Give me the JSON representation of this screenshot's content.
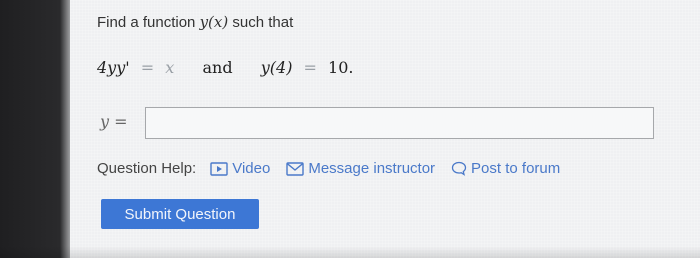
{
  "question": {
    "prompt_text": "Find a function",
    "prompt_math": "y(x)",
    "prompt_suffix": "such that",
    "equation_lhs": "4yy'",
    "equation_eq1": "=",
    "equation_rhs": "x",
    "equation_and": "and",
    "condition_lhs": "y(4)",
    "condition_eq": "=",
    "condition_rhs": "10."
  },
  "answer": {
    "label": "y =",
    "value": "",
    "placeholder": ""
  },
  "help": {
    "label": "Question Help:",
    "video_label": "Video",
    "message_label": "Message instructor",
    "forum_label": "Post to forum"
  },
  "submit": {
    "label": "Submit Question"
  },
  "colors": {
    "link": "#4a79c9",
    "button": "#3d77d5",
    "text": "#333333"
  },
  "icons": {
    "video": "play-icon",
    "message": "mail-icon",
    "forum": "chat-bubble-icon"
  }
}
